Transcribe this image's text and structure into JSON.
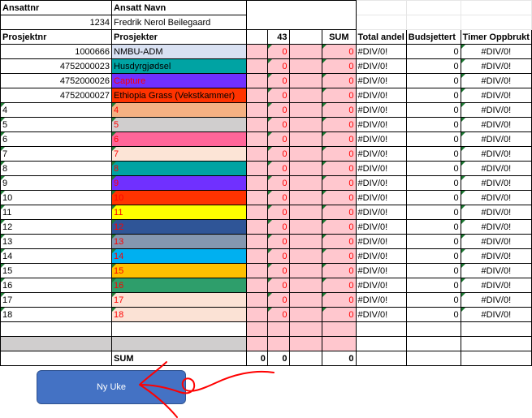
{
  "header": {
    "employee_no_label": "Ansattnr",
    "employee_name_label": "Ansatt Navn",
    "employee_no": "1234",
    "employee_name": "Fredrik Nerol Beilegaard"
  },
  "columns": {
    "project_no": "Prosjektnr",
    "projects": "Prosjekter",
    "week": "43",
    "sum": "SUM",
    "total_share": "Total andel",
    "budgeted": "Budsjettert",
    "hours_used": "Timer Oppbrukt"
  },
  "rows": [
    {
      "no": "1000666",
      "name": "NMBU-ADM",
      "color": "#d9e1f2",
      "text_color": "#000000",
      "week": "0",
      "sum": "0",
      "share": "#DIV/0!",
      "budget": "0",
      "used": "#DIV/0!",
      "left_align": false
    },
    {
      "no": "4752000023",
      "name": "Husdyrgjødsel",
      "color": "#00a3a3",
      "text_color": "#000000",
      "week": "0",
      "sum": "0",
      "share": "#DIV/0!",
      "budget": "0",
      "used": "#DIV/0!",
      "left_align": false
    },
    {
      "no": "4752000026",
      "name": "Capture",
      "color": "#7030ff",
      "text_color": "#ff0000",
      "week": "0",
      "sum": "0",
      "share": "#DIV/0!",
      "budget": "0",
      "used": "#DIV/0!",
      "left_align": false
    },
    {
      "no": "4752000027",
      "name": "Ethiopia Grass (Vekstkammer)",
      "color": "#ff3300",
      "text_color": "#000000",
      "week": "0",
      "sum": "0",
      "share": "#DIV/0!",
      "budget": "0",
      "used": "#DIV/0!",
      "left_align": false
    },
    {
      "no": "4",
      "name": "4",
      "color": "#f4b183",
      "text_color": "#ff0000",
      "week": "0",
      "sum": "0",
      "share": "#DIV/0!",
      "budget": "0",
      "used": "#DIV/0!",
      "left_align": true
    },
    {
      "no": "5",
      "name": "5",
      "color": "#d0cece",
      "text_color": "#ff0000",
      "week": "0",
      "sum": "0",
      "share": "#DIV/0!",
      "budget": "0",
      "used": "#DIV/0!",
      "left_align": true
    },
    {
      "no": "6",
      "name": "6",
      "color": "#ff6699",
      "text_color": "#ff0000",
      "week": "0",
      "sum": "0",
      "share": "#DIV/0!",
      "budget": "0",
      "used": "#DIV/0!",
      "left_align": true
    },
    {
      "no": "7",
      "name": "7",
      "color": "#fce4d6",
      "text_color": "#ff0000",
      "week": "0",
      "sum": "0",
      "share": "#DIV/0!",
      "budget": "0",
      "used": "#DIV/0!",
      "left_align": true
    },
    {
      "no": "8",
      "name": "8",
      "color": "#00a3a3",
      "text_color": "#ff0000",
      "week": "0",
      "sum": "0",
      "share": "#DIV/0!",
      "budget": "0",
      "used": "#DIV/0!",
      "left_align": true
    },
    {
      "no": "9",
      "name": "9",
      "color": "#7030ff",
      "text_color": "#ff0000",
      "week": "0",
      "sum": "0",
      "share": "#DIV/0!",
      "budget": "0",
      "used": "#DIV/0!",
      "left_align": true
    },
    {
      "no": "10",
      "name": "10",
      "color": "#ff3300",
      "text_color": "#ff0000",
      "week": "0",
      "sum": "0",
      "share": "#DIV/0!",
      "budget": "0",
      "used": "#DIV/0!",
      "left_align": true
    },
    {
      "no": "11",
      "name": "11",
      "color": "#ffff00",
      "text_color": "#ff0000",
      "week": "0",
      "sum": "0",
      "share": "#DIV/0!",
      "budget": "0",
      "used": "#DIV/0!",
      "left_align": true
    },
    {
      "no": "12",
      "name": "12",
      "color": "#2f5597",
      "text_color": "#ff0000",
      "week": "0",
      "sum": "0",
      "share": "#DIV/0!",
      "budget": "0",
      "used": "#DIV/0!",
      "left_align": true
    },
    {
      "no": "13",
      "name": "13",
      "color": "#8497b0",
      "text_color": "#ff0000",
      "week": "0",
      "sum": "0",
      "share": "#DIV/0!",
      "budget": "0",
      "used": "#DIV/0!",
      "left_align": true
    },
    {
      "no": "14",
      "name": "14",
      "color": "#00b0f0",
      "text_color": "#ff0000",
      "week": "0",
      "sum": "0",
      "share": "#DIV/0!",
      "budget": "0",
      "used": "#DIV/0!",
      "left_align": true
    },
    {
      "no": "15",
      "name": "15",
      "color": "#ffc000",
      "text_color": "#ff0000",
      "week": "0",
      "sum": "0",
      "share": "#DIV/0!",
      "budget": "0",
      "used": "#DIV/0!",
      "left_align": true
    },
    {
      "no": "16",
      "name": "16",
      "color": "#2e9e6b",
      "text_color": "#ff0000",
      "week": "0",
      "sum": "0",
      "share": "#DIV/0!",
      "budget": "0",
      "used": "#DIV/0!",
      "left_align": true
    },
    {
      "no": "17",
      "name": "17",
      "color": "#fbe2d5",
      "text_color": "#ff0000",
      "week": "0",
      "sum": "0",
      "share": "#DIV/0!",
      "budget": "0",
      "used": "#DIV/0!",
      "left_align": true
    },
    {
      "no": "18",
      "name": "18",
      "color": "#fbe2d5",
      "text_color": "#ff0000",
      "week": "0",
      "sum": "0",
      "share": "#DIV/0!",
      "budget": "0",
      "used": "#DIV/0!",
      "left_align": true
    }
  ],
  "footer": {
    "sum_label": "SUM",
    "col_blank_total": "0",
    "week_total": "0",
    "sum_total": "0"
  },
  "button": {
    "label": "Ny Uke"
  },
  "colors": {
    "week_fill": "#ffc7ce",
    "button": "#4472c4",
    "annotation": "#ff0000"
  }
}
